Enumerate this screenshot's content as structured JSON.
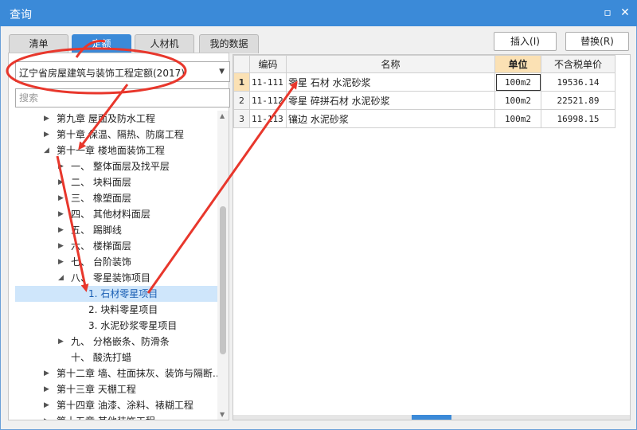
{
  "window": {
    "title": "查询",
    "restore_icon": "restore-icon",
    "close_icon": "close-icon"
  },
  "tabs": [
    {
      "label": "清单",
      "active": false
    },
    {
      "label": "定额",
      "active": true
    },
    {
      "label": "人材机",
      "active": false
    },
    {
      "label": "我的数据",
      "active": false
    }
  ],
  "toolbar": {
    "insert_label": "插入(I)",
    "replace_label": "替换(R)"
  },
  "library": {
    "selected": "辽宁省房屋建筑与装饰工程定额(2017)"
  },
  "search": {
    "placeholder": "搜索"
  },
  "tree": [
    {
      "label": "第九章 屋面及防水工程",
      "twisty": "▶"
    },
    {
      "label": "第十章 保温、隔热、防腐工程",
      "twisty": "▶"
    },
    {
      "label": "第十一章 楼地面装饰工程",
      "twisty": "◢"
    },
    {
      "label": "一、 整体面层及找平层",
      "twisty": "▶"
    },
    {
      "label": "二、 块料面层",
      "twisty": "▶"
    },
    {
      "label": "三、 橡塑面层",
      "twisty": "▶"
    },
    {
      "label": "四、 其他材料面层",
      "twisty": "▶"
    },
    {
      "label": "五、 踢脚线",
      "twisty": "▶"
    },
    {
      "label": "六、 楼梯面层",
      "twisty": "▶"
    },
    {
      "label": "七、 台阶装饰",
      "twisty": "▶"
    },
    {
      "label": "八、 零星装饰项目",
      "twisty": "◢"
    },
    {
      "label": "1. 石材零星项目",
      "twisty": ""
    },
    {
      "label": "2. 块料零星项目",
      "twisty": ""
    },
    {
      "label": "3. 水泥砂浆零星项目",
      "twisty": ""
    },
    {
      "label": "九、 分格嵌条、防滑条",
      "twisty": "▶"
    },
    {
      "label": "十、 酸洗打蜡",
      "twisty": ""
    },
    {
      "label": "第十二章 墙、柱面抹灰、装饰与隔断…",
      "twisty": "▶"
    },
    {
      "label": "第十三章 天棚工程",
      "twisty": "▶"
    },
    {
      "label": "第十四章 油漆、涂料、裱糊工程",
      "twisty": "▶"
    },
    {
      "label": "第十五章 其他装饰工程",
      "twisty": "▶"
    }
  ],
  "grid": {
    "headers": {
      "code": "编码",
      "name": "名称",
      "unit": "单位",
      "price": "不含税单价"
    },
    "rows": [
      {
        "no": "1",
        "code": "11-111",
        "name": "零星 石材 水泥砂浆",
        "unit": "100m2",
        "price": "19536.14"
      },
      {
        "no": "2",
        "code": "11-112",
        "name": "零星 碎拼石材 水泥砂浆",
        "unit": "100m2",
        "price": "22521.89"
      },
      {
        "no": "3",
        "code": "11-113",
        "name": "镶边 水泥砂浆",
        "unit": "100m2",
        "price": "16998.15"
      }
    ]
  },
  "colors": {
    "accent": "#3b8ad8",
    "annotation": "#e8372c",
    "header_highlight": "#fbe1b4"
  }
}
